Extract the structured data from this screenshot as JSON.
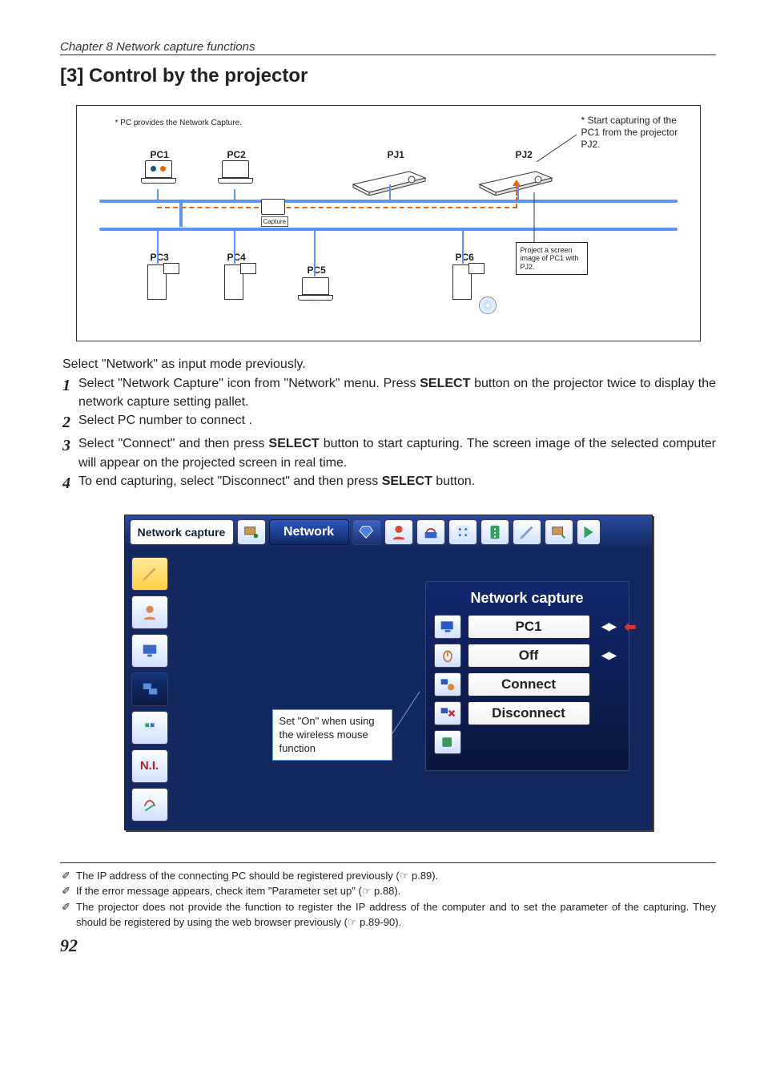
{
  "chapter_line": "Chapter 8 Network capture functions",
  "section_title": "[3] Control by the projector",
  "diagram": {
    "pc_note": "* PC provides the Network Capture.",
    "start_note": "* Start capturing of the PC1 from the projector PJ2.",
    "labels": {
      "pc1": "PC1",
      "pc2": "PC2",
      "pc3": "PC3",
      "pc4": "PC4",
      "pc5": "PC5",
      "pc6": "PC6",
      "pj1": "PJ1",
      "pj2": "PJ2"
    },
    "capture_tag": "Capture",
    "callout": "Project a screen image of PC1 with PJ2."
  },
  "intro": "Select \"Network\" as input mode previously.",
  "steps": {
    "s1_a": "Select \"Network Capture\" icon from \"Network\" menu. Press ",
    "s1_b": "SELECT",
    "s1_c": " button on the projector twice to display the network capture setting pallet.",
    "s2": "Select PC number to connect .",
    "s3_a": "Select \"Connect\" and then press ",
    "s3_b": "SELECT",
    "s3_c": " button to start capturing. The screen image of the selected computer will appear on the projected screen in real time.",
    "s4_a": "To end capturing, select \"Disconnect\" and then press ",
    "s4_b": "SELECT",
    "s4_c": " button."
  },
  "screenshot": {
    "top": {
      "network_capture": "Network capture",
      "network": "Network"
    },
    "left_ni": "N.I.",
    "panel": {
      "title": "Network capture",
      "r1": "PC1",
      "r2": "Off",
      "r3": "Connect",
      "r4": "Disconnect"
    },
    "note": "Set \"On\" when using the wireless mouse function"
  },
  "footnotes": {
    "f1": "The IP address of the connecting PC should be registered previously (☞ p.89).",
    "f2": "If the error message appears, check item \"Parameter set up\"  (☞ p.88).",
    "f3": "The projector does not provide the function to register the IP address of the computer and to set the parameter of the capturing. They should be registered by using the web browser previously (☞ p.89-90)."
  },
  "page_number": "92",
  "marker": "✐"
}
